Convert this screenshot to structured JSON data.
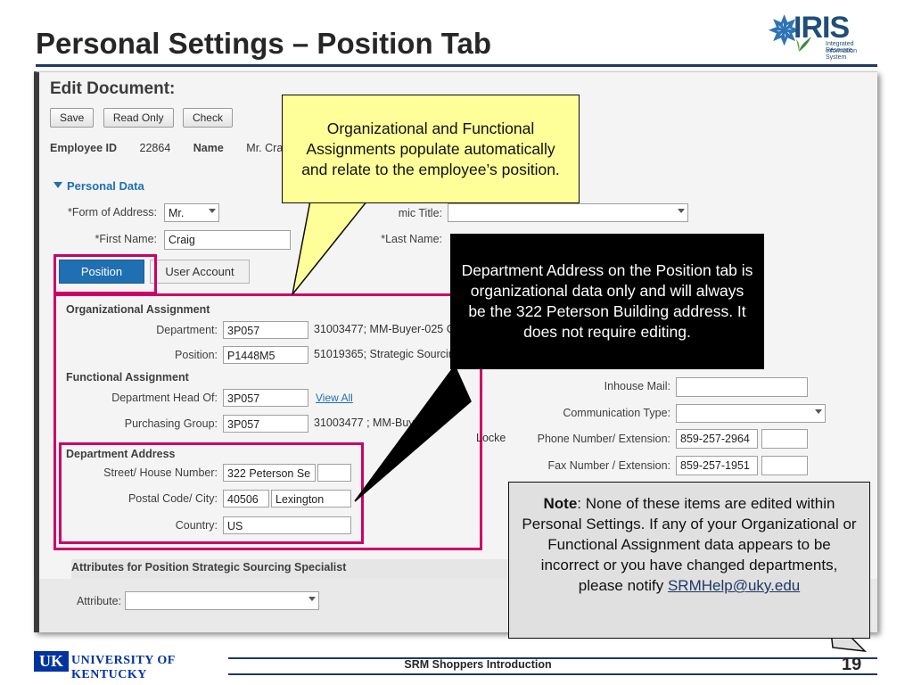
{
  "slide": {
    "title": "Personal Settings – Position Tab",
    "page_number": "19",
    "footer_text": "SRM Shoppers Introduction",
    "accent_color": "#1f3864",
    "magenta_color": "#cc0066"
  },
  "logo": {
    "brand": "IRIS",
    "sub_line1": "Integrated Resource",
    "sub_line2": "Information System"
  },
  "uk_logo": {
    "mark": "UK",
    "text": "UNIVERSITY OF KENTUCKY"
  },
  "screenshot": {
    "heading": "Edit Document:",
    "buttons": [
      "Save",
      "Read Only",
      "Check"
    ],
    "employee_id_label": "Employee ID",
    "employee_id_value": "22864",
    "name_label": "Name",
    "name_value": "Mr. Craig L",
    "personal_data_section": "Personal Data",
    "form_of_address_label": "*Form of Address:",
    "form_of_address_value": "Mr.",
    "academic_title_label": "mic Title:",
    "academic_title_value": "",
    "first_name_label": "*First Name:",
    "first_name_value": "Craig",
    "last_name_label": "*Last Name:",
    "tabs": [
      {
        "label": "Position",
        "active": true
      },
      {
        "label": "User Account",
        "active": false
      }
    ],
    "organizational_assignment": {
      "group_title": "Organizational Assignment",
      "department_label": "Department:",
      "department_code": "3P057",
      "department_text": "31003477; MM-Buyer-025 C",
      "position_label": "Position:",
      "position_code": "P1448M5",
      "position_text": "51019365; Strategic Sourcin"
    },
    "functional_assignment": {
      "group_title": "Functional Assignment",
      "dept_head_label": "Department Head Of:",
      "dept_head_code": "3P057",
      "view_all_link": "View All",
      "purchasing_group_label": "Purchasing Group:",
      "purchasing_group_code": "3P057",
      "purchasing_group_text": "31003477 ; MM-Buyer-0",
      "trailing_text": "Locke"
    },
    "department_address": {
      "group_title": "Department Address",
      "street_label": "Street/ House Number:",
      "street_value": "322 Peterson Se",
      "street_number_value": "",
      "postal_label": "Postal Code/ City:",
      "postal_value": "40506",
      "city_value": "Lexington",
      "country_label": "Country:",
      "country_value": "US"
    },
    "right_fields": {
      "inhouse_mail_label": "Inhouse Mail:",
      "inhouse_mail_value": "",
      "communication_type_label": "Communication Type:",
      "communication_type_value": "",
      "phone_label": "Phone Number/ Extension:",
      "phone_value": "859-257-2964",
      "phone_ext_value": "",
      "fax_label": "Fax Number / Extension:",
      "fax_value": "859-257-1951",
      "fax_ext_value": ""
    },
    "attributes": {
      "section_title": "Attributes for Position Strategic Sourcing Specialist",
      "attribute_label": "Attribute:",
      "attribute_value": ""
    }
  },
  "callouts": {
    "yellow_top": "Organizational and Functional Assignments populate automatically and relate to the employee’s position.",
    "black": "Department Address on the Position tab is organizational data only and will always be the 322 Peterson Building address. It does not require editing.",
    "note_bold": "Note",
    "note_text": ": None of these items are edited within Personal Settings. If any of your Organizational or Functional Assignment data appears to be incorrect or you have changed departments, please notify ",
    "note_link": "SRMHelp@uky.edu"
  }
}
